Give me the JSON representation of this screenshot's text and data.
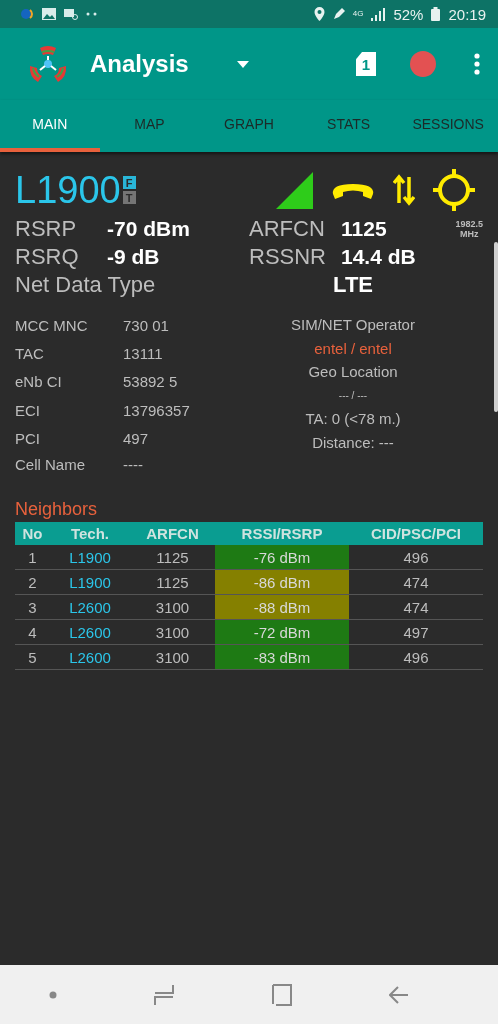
{
  "status_bar": {
    "network": "4G",
    "battery": "52%",
    "time": "20:19"
  },
  "app_bar": {
    "title": "Analysis",
    "sim_slot": "1",
    "recording": true
  },
  "tabs": [
    {
      "label": "MAIN",
      "selected": true
    },
    {
      "label": "MAP",
      "selected": false
    },
    {
      "label": "GRAPH",
      "selected": false
    },
    {
      "label": "STATS",
      "selected": false
    },
    {
      "label": "SESSIONS",
      "selected": false
    }
  ],
  "cell": {
    "band": "L1900",
    "badges": [
      {
        "text": "F",
        "color": "#29b6d8"
      },
      {
        "text": "T",
        "color": "#757575"
      }
    ]
  },
  "metrics": [
    {
      "label": "RSRP",
      "value": "-70 dBm"
    },
    {
      "label": "ARFCN",
      "value": "1125",
      "note": [
        "1982.5",
        "MHz"
      ]
    },
    {
      "label": "RSRQ",
      "value": "-9 dB"
    },
    {
      "label": "RSSNR",
      "value": "14.4 dB"
    }
  ],
  "net_data_type": {
    "label": "Net Data Type",
    "value": "LTE"
  },
  "details": [
    {
      "label": "MCC MNC",
      "value": "730 01"
    },
    {
      "label": "TAC",
      "value": "13111"
    },
    {
      "label": "eNb CI",
      "value": "53892 5"
    },
    {
      "label": "ECI",
      "value": "13796357"
    },
    {
      "label": "PCI",
      "value": "497"
    }
  ],
  "side_info": [
    {
      "text": "SIM/NET Operator",
      "kind": "label"
    },
    {
      "text": "entel / entel",
      "kind": "operator"
    },
    {
      "text": "Geo Location",
      "kind": "label"
    },
    {
      "text": "--- / ---",
      "kind": "dim"
    },
    {
      "text": "TA: 0 (<78 m.)",
      "kind": "label"
    },
    {
      "text": "Distance: ---",
      "kind": "label"
    }
  ],
  "cell_name": {
    "label": "Cell Name",
    "value": "----"
  },
  "neighbors": {
    "title": "Neighbors",
    "columns": [
      "No",
      "Tech.",
      "ARFCN",
      "RSSI/RSRP",
      "CID/PSC/PCI"
    ],
    "rows": [
      {
        "no": "1",
        "tech": "L1900",
        "arfcn": "1125",
        "signal": "-76 dBm",
        "color": "#1e7a14",
        "id": "496"
      },
      {
        "no": "2",
        "tech": "L1900",
        "arfcn": "1125",
        "signal": "-86 dBm",
        "color": "#858000",
        "id": "474"
      },
      {
        "no": "3",
        "tech": "L2600",
        "arfcn": "3100",
        "signal": "-88 dBm",
        "color": "#858000",
        "id": "474"
      },
      {
        "no": "4",
        "tech": "L2600",
        "arfcn": "3100",
        "signal": "-72 dBm",
        "color": "#1e7a14",
        "id": "497"
      },
      {
        "no": "5",
        "tech": "L2600",
        "arfcn": "3100",
        "signal": "-83 dBm",
        "color": "#1e7a14",
        "id": "496"
      }
    ]
  }
}
